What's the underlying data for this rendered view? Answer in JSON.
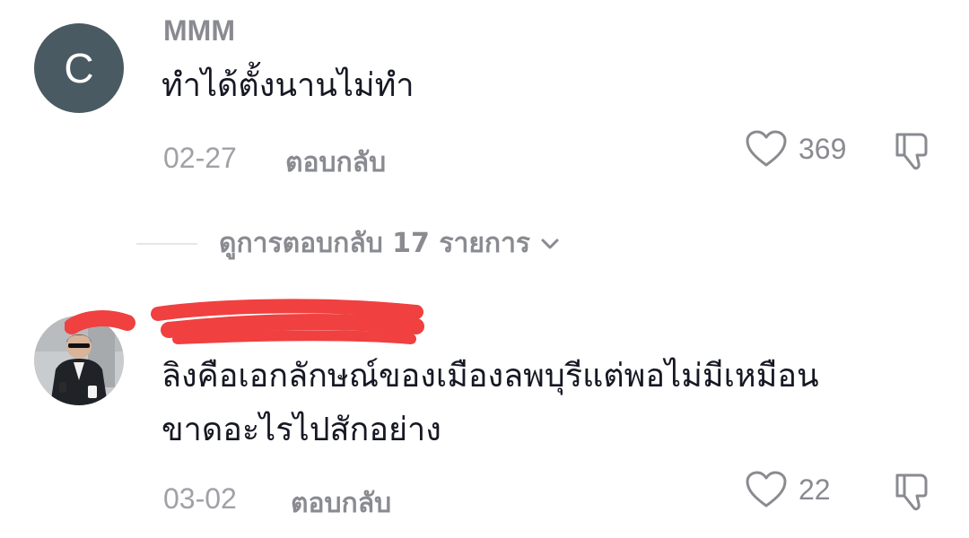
{
  "comments": [
    {
      "avatar_letter": "C",
      "username": "MMM",
      "text": "ทำได้ตั้งนานไม่ทำ",
      "date": "02-27",
      "reply_label": "ตอบกลับ",
      "likes": "369"
    },
    {
      "username": "",
      "text_line1": "ลิงคือเอกลักษณ์ของเมืองลพบุรีแต่พอไม่มีเหมือน",
      "text_line2": "ขาดอะไรไปสักอย่าง",
      "date": "03-02",
      "reply_label": "ตอบกลับ",
      "likes": "22"
    }
  ],
  "view_replies": {
    "label": "ดูการตอบกลับ 17 รายการ"
  },
  "colors": {
    "avatar_bg": "#4a5a62",
    "redaction": "#f04040",
    "meta_gray": "#8a8b91"
  },
  "icons": {
    "like": "heart-icon",
    "dislike": "thumbs-down-icon",
    "expand": "chevron-down-icon"
  }
}
